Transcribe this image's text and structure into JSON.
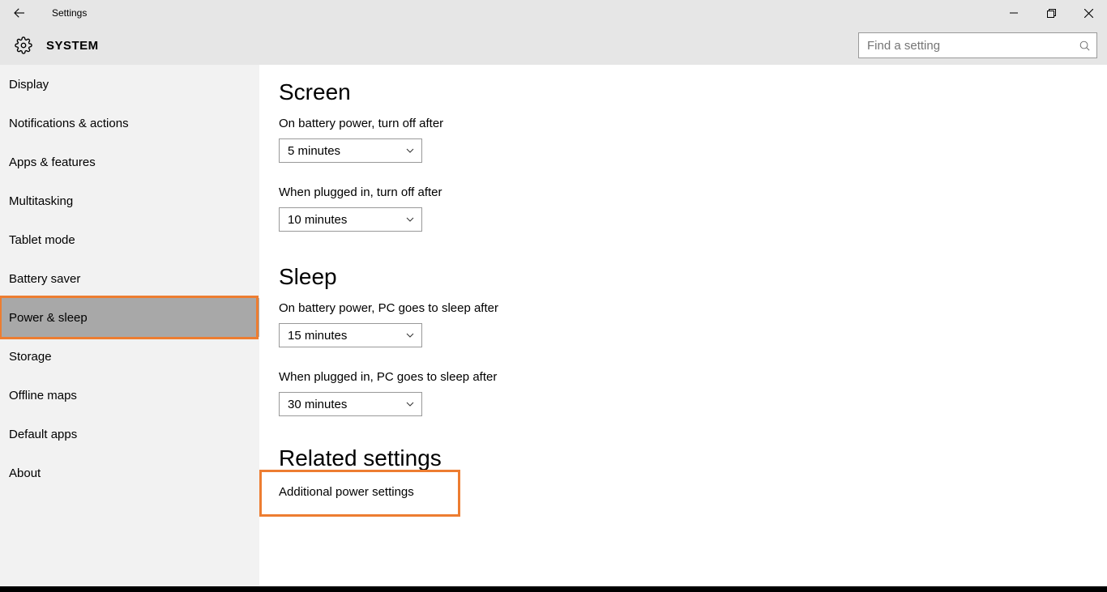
{
  "window": {
    "title": "Settings",
    "subtitle": "SYSTEM",
    "search_placeholder": "Find a setting"
  },
  "sidebar": {
    "items": [
      {
        "label": "Display"
      },
      {
        "label": "Notifications & actions"
      },
      {
        "label": "Apps & features"
      },
      {
        "label": "Multitasking"
      },
      {
        "label": "Tablet mode"
      },
      {
        "label": "Battery saver"
      },
      {
        "label": "Power & sleep"
      },
      {
        "label": "Storage"
      },
      {
        "label": "Offline maps"
      },
      {
        "label": "Default apps"
      },
      {
        "label": "About"
      }
    ],
    "selected_index": 6
  },
  "content": {
    "screen": {
      "title": "Screen",
      "battery_label": "On battery power, turn off after",
      "battery_value": "5 minutes",
      "plugged_label": "When plugged in, turn off after",
      "plugged_value": "10 minutes"
    },
    "sleep": {
      "title": "Sleep",
      "battery_label": "On battery power, PC goes to sleep after",
      "battery_value": "15 minutes",
      "plugged_label": "When plugged in, PC goes to sleep after",
      "plugged_value": "30 minutes"
    },
    "related": {
      "title": "Related settings",
      "link": "Additional power settings"
    }
  },
  "highlights": {
    "accent": "#ed7d31"
  }
}
